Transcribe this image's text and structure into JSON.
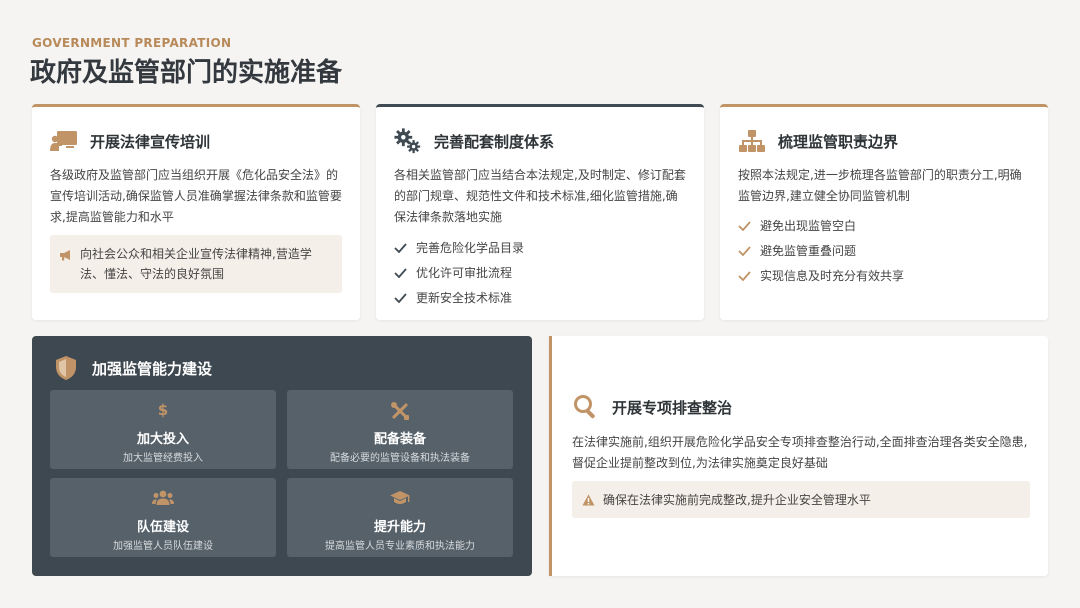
{
  "header": {
    "eyebrow": "GOVERNMENT PREPARATION",
    "title": "政府及监管部门的实施准备"
  },
  "cards": [
    {
      "title": "开展法律宣传培训",
      "icon": "presentation-icon",
      "body": "各级政府及监管部门应当组织开展《危化品安全法》的宣传培训活动,确保监管人员准确掌握法律条款和监管要求,提高监管能力和水平",
      "note": "向社会公众和相关企业宣传法律精神,营造学法、懂法、守法的良好氛围",
      "note_icon": "megaphone-icon"
    },
    {
      "title": "完善配套制度体系",
      "icon": "gears-icon",
      "body": "各相关监管部门应当结合本法规定,及时制定、修订配套的部门规章、规范性文件和技术标准,细化监管措施,确保法律条款落地实施",
      "checks": [
        "完善危险化学品目录",
        "优化许可审批流程",
        "更新安全技术标准"
      ]
    },
    {
      "title": "梳理监管职责边界",
      "icon": "org-chart-icon",
      "body": "按照本法规定,进一步梳理各监管部门的职责分工,明确监管边界,建立健全协同监管机制",
      "checks": [
        "避免出现监管空白",
        "避免监管重叠问题",
        "实现信息及时充分有效共享"
      ]
    }
  ],
  "capacity": {
    "title": "加强监管能力建设",
    "icon": "shield-icon",
    "tiles": [
      {
        "title": "加大投入",
        "sub": "加大监管经费投入",
        "icon": "dollar-icon"
      },
      {
        "title": "配备装备",
        "sub": "配备必要的监管设备和执法装备",
        "icon": "tools-icon"
      },
      {
        "title": "队伍建设",
        "sub": "加强监管人员队伍建设",
        "icon": "users-icon"
      },
      {
        "title": "提升能力",
        "sub": "提高监管人员专业素质和执法能力",
        "icon": "graduation-cap-icon"
      }
    ]
  },
  "inspection": {
    "title": "开展专项排查整治",
    "icon": "search-icon",
    "body": "在法律实施前,组织开展危险化学品安全专项排查整治行动,全面排查治理各类安全隐患,督促企业提前整改到位,为法律实施奠定良好基础",
    "warning": "确保在法律实施前完成整改,提升企业安全管理水平",
    "warning_icon": "warning-icon"
  },
  "colors": {
    "accent": "#c09467",
    "dark": "#3e4850",
    "tile": "#56616a",
    "note_bg": "#f5efe9"
  }
}
